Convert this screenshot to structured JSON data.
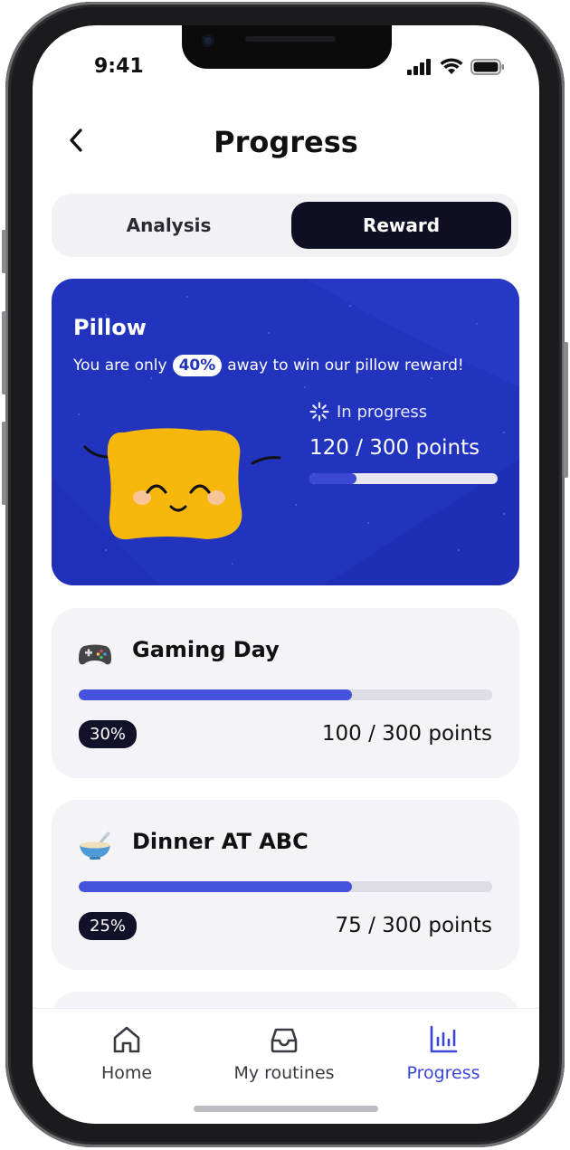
{
  "status_bar": {
    "time": "9:41"
  },
  "header": {
    "title": "Progress"
  },
  "tabs": [
    {
      "label": "Analysis",
      "active": false
    },
    {
      "label": "Reward",
      "active": true
    }
  ],
  "reward": {
    "title": "Pillow",
    "desc_prefix": "You are only",
    "percent_badge": "40%",
    "desc_suffix": "away to win our pillow reward!",
    "status": "In progress",
    "points": "120 / 300 points",
    "progress_fraction": 0.25,
    "card_color": "#2233be"
  },
  "challenges": [
    {
      "icon": "gamepad-icon",
      "title": "Gaming Day",
      "badge": "30%",
      "points": "100 / 300 points",
      "progress_fraction": 0.66
    },
    {
      "icon": "bowl-icon",
      "title": "Dinner AT ABC",
      "badge": "25%",
      "points": "75 / 300 points",
      "progress_fraction": 0.66
    }
  ],
  "nav": [
    {
      "label": "Home",
      "icon": "home-icon",
      "active": false
    },
    {
      "label": "My routines",
      "icon": "inbox-icon",
      "active": false
    },
    {
      "label": "Progress",
      "icon": "chart-icon",
      "active": true
    }
  ],
  "colors": {
    "accent": "#3b45d9",
    "dark": "#0f0f23"
  }
}
